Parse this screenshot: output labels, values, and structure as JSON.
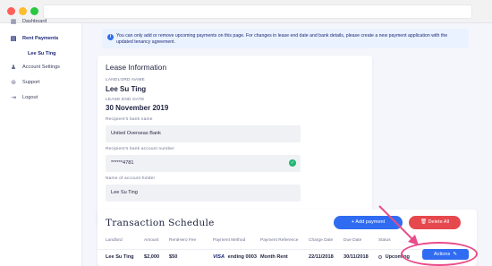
{
  "colors": {
    "accent": "#2f6cf2",
    "danger": "#e5484d",
    "success": "#22b573",
    "annotation": "#e84c8a",
    "text_dark": "#1f2340"
  },
  "sidebar": {
    "items": [
      {
        "label": "Dashboard",
        "icon": "grid-icon"
      },
      {
        "label": "Rent Payments",
        "icon": "payments-icon",
        "active": true
      },
      {
        "label": "Lee Su Ting",
        "sub": true
      },
      {
        "label": "Account Settings",
        "icon": "person-icon"
      },
      {
        "label": "Support",
        "icon": "lifebuoy-icon"
      },
      {
        "label": "Logout",
        "icon": "logout-icon"
      }
    ]
  },
  "notice": {
    "text": "You can only add or remove upcoming payments on this page. For changes in lease end date and bank details, please create a new payment application with the updated tenancy agreement."
  },
  "lease": {
    "title": "Lease Information",
    "landlord_label": "LANDLORD NAME",
    "landlord_value": "Lee Su Ting",
    "end_date_label": "LEASE END DATE",
    "end_date_value": "30 November 2019",
    "bank_name_label": "Recipient's bank name",
    "bank_name_value": "United Overseas Bank",
    "account_label": "Recipient's bank account number",
    "account_value": "******4781",
    "holder_label": "Name of account holder",
    "holder_value": "Lee Su Ting"
  },
  "transactions": {
    "title": "Transaction Schedule",
    "add_label": "+ Add payment",
    "delete_label": "Delete All",
    "columns": [
      "Landlord",
      "Amount",
      "RentHero Fee",
      "Payment Method",
      "Payment Reference",
      "Charge Date",
      "Due Date",
      "Status"
    ],
    "rows": [
      {
        "landlord": "Lee Su Ting",
        "amount": "$2,000",
        "fee": "$50",
        "method_brand": "VISA",
        "method_text": "ending 0003",
        "reference": "Month Rent",
        "charge_date": "22/11/2018",
        "due_date": "30/11/2018",
        "status": "Upcoming",
        "actions_label": "Actions"
      }
    ]
  }
}
